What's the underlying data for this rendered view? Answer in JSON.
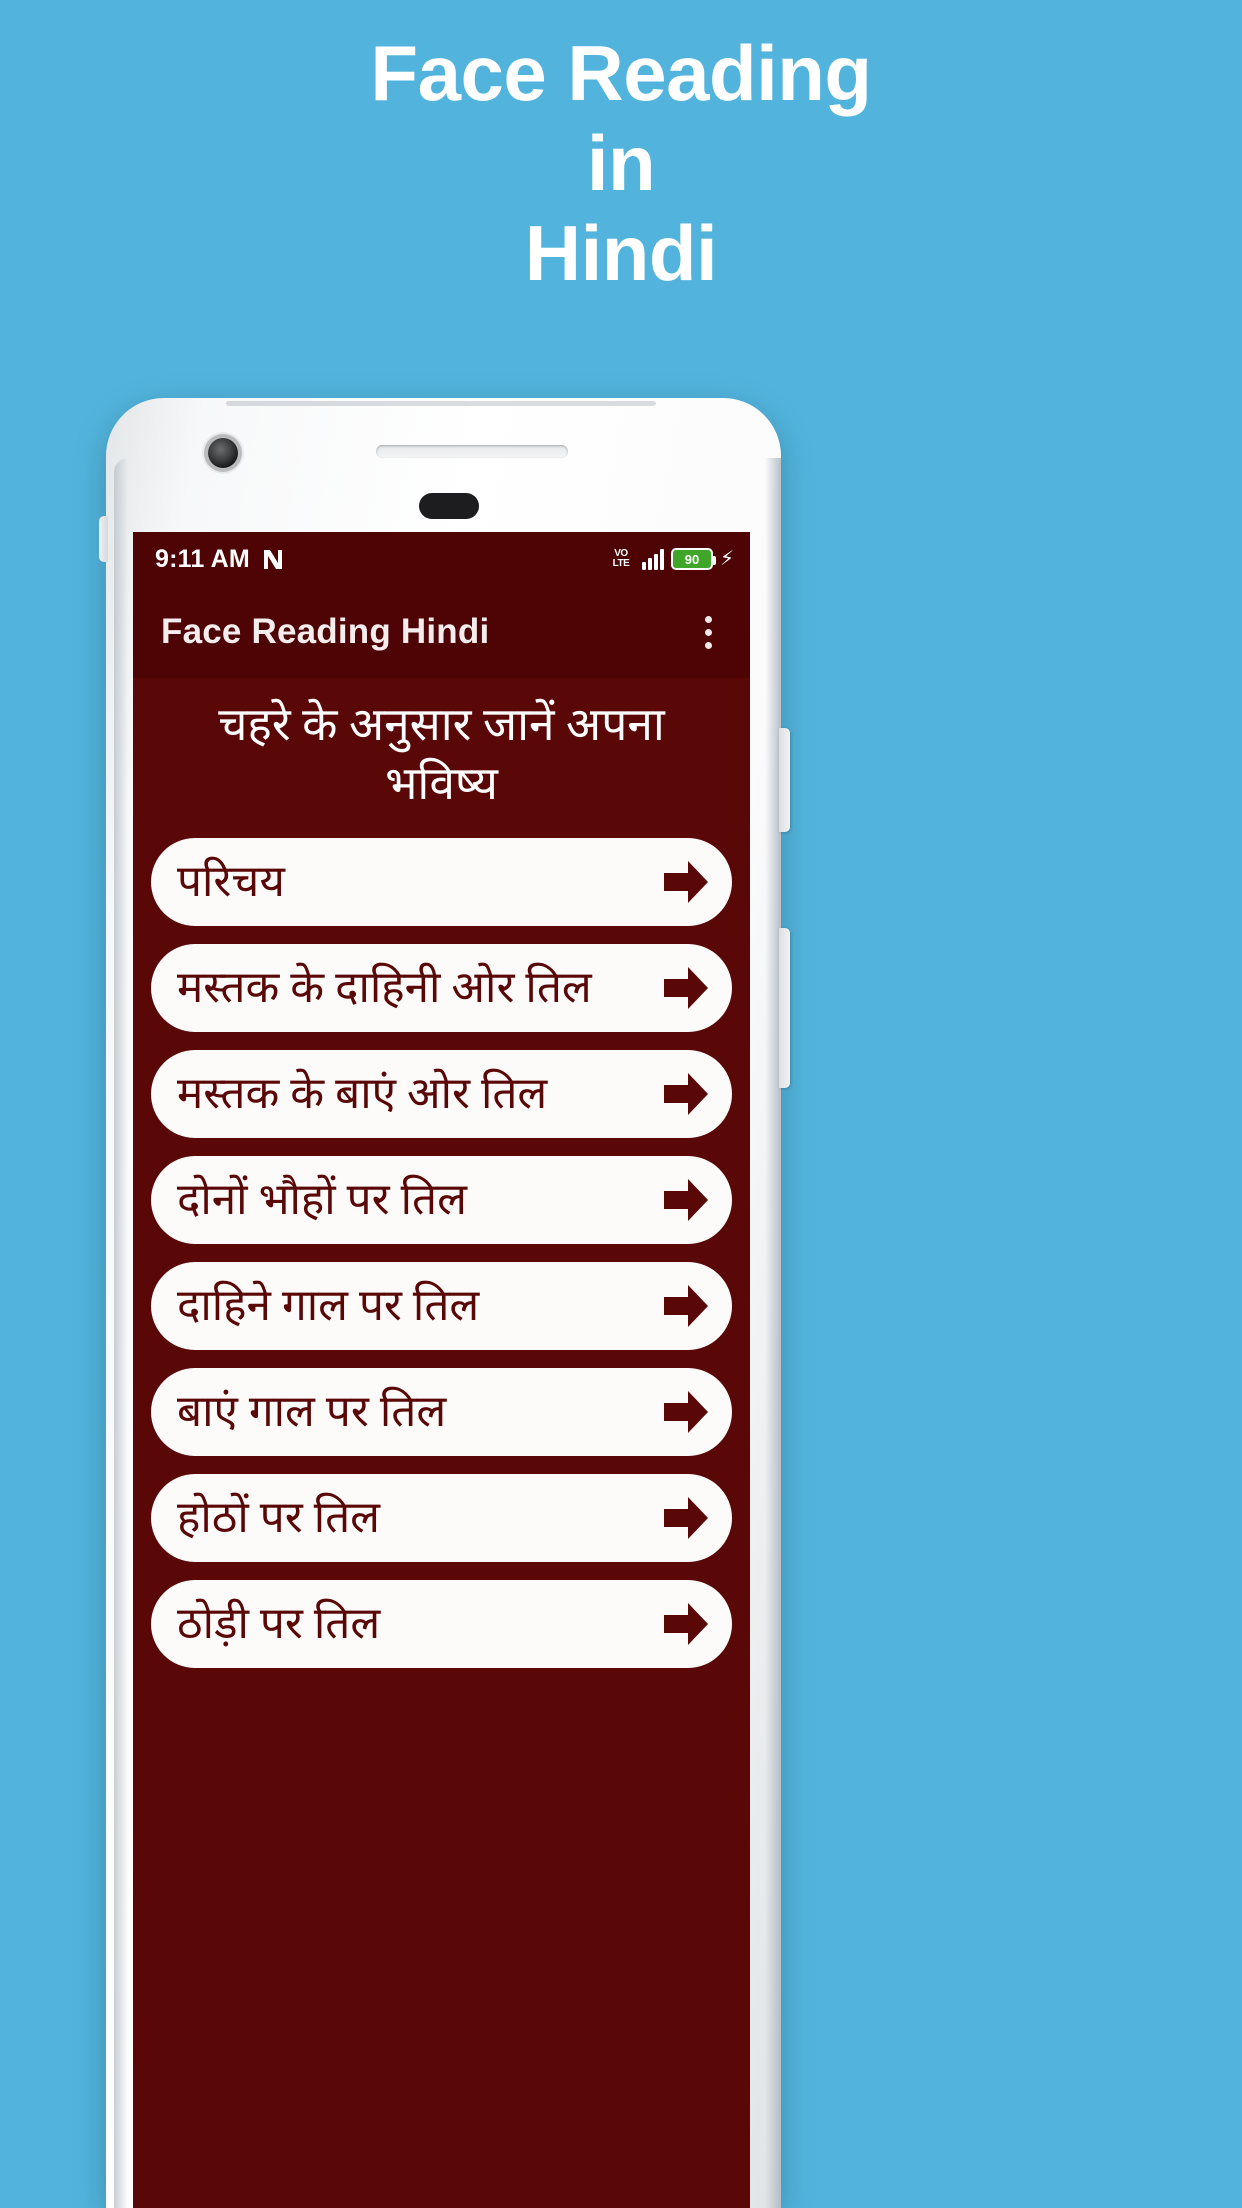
{
  "promo": {
    "lines": [
      "Face Reading",
      "in",
      "Hindi"
    ],
    "background_color": "#52b4dd",
    "text_color": "#ffffff"
  },
  "phone": {
    "camera_icon": "front-camera-icon",
    "earpiece_icon": "earpiece-speaker-icon",
    "sensor_icon": "proximity-sensor-icon"
  },
  "status_bar": {
    "time": "9:11 AM",
    "nfc_icon": "nfc-icon",
    "volte_top": "VO",
    "volte_bottom": "LTE",
    "signal_icon": "signal-bars-icon",
    "battery_level": "90",
    "charging_icon": "lightning-bolt-icon",
    "background_color": "#4e0404"
  },
  "app_bar": {
    "title": "Face Reading Hindi",
    "overflow_icon": "more-vertical-icon"
  },
  "screen": {
    "heading": "चहरे के अनुसार जानें अपना भविष्य",
    "background_color": "#5a0707",
    "accent_color": "#5a0707"
  },
  "menu": {
    "arrow_icon": "arrow-right-icon",
    "items": [
      {
        "label": "परिचय"
      },
      {
        "label": "मस्तक के दाहिनी ओर तिल"
      },
      {
        "label": "मस्तक के बाएं ओर तिल"
      },
      {
        "label": "दोनों भौहों पर तिल"
      },
      {
        "label": "दाहिने गाल पर तिल"
      },
      {
        "label": "बाएं गाल पर तिल"
      },
      {
        "label": "होठों पर तिल"
      },
      {
        "label": "ठोड़ी पर तिल"
      }
    ]
  }
}
